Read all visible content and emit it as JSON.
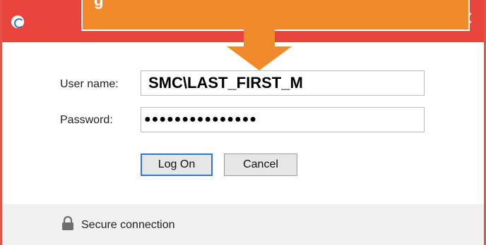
{
  "window": {
    "app_icon": "circular-logo-icon",
    "close_icon": "close-icon"
  },
  "callout": {
    "text": "g"
  },
  "form": {
    "username_label": "User name:",
    "username_value": "SMC\\LAST_FIRST_M",
    "password_label": "Password:",
    "password_mask": "●●●●●●●●●●●●●●●"
  },
  "buttons": {
    "logon_label": "Log On",
    "cancel_label": "Cancel"
  },
  "footer": {
    "lock_icon": "lock-icon",
    "status_text": "Secure connection"
  },
  "colors": {
    "titlebar": "#e9453d",
    "callout": "#f08a2b",
    "focus_border": "#2a78d4"
  }
}
